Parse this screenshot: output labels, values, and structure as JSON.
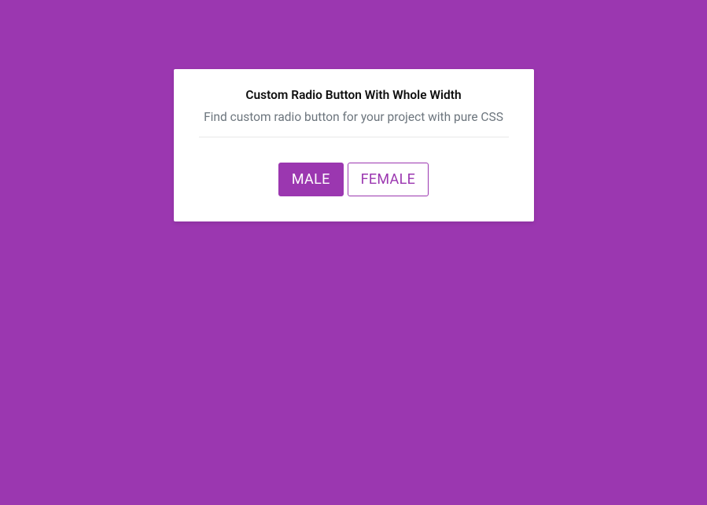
{
  "card": {
    "heading": "Custom Radio Button With Whole Width",
    "subheading": "Find custom radio button for your project with pure CSS"
  },
  "radio": {
    "options": [
      {
        "label": "MALE",
        "selected": true
      },
      {
        "label": "FEMALE",
        "selected": false
      }
    ]
  }
}
